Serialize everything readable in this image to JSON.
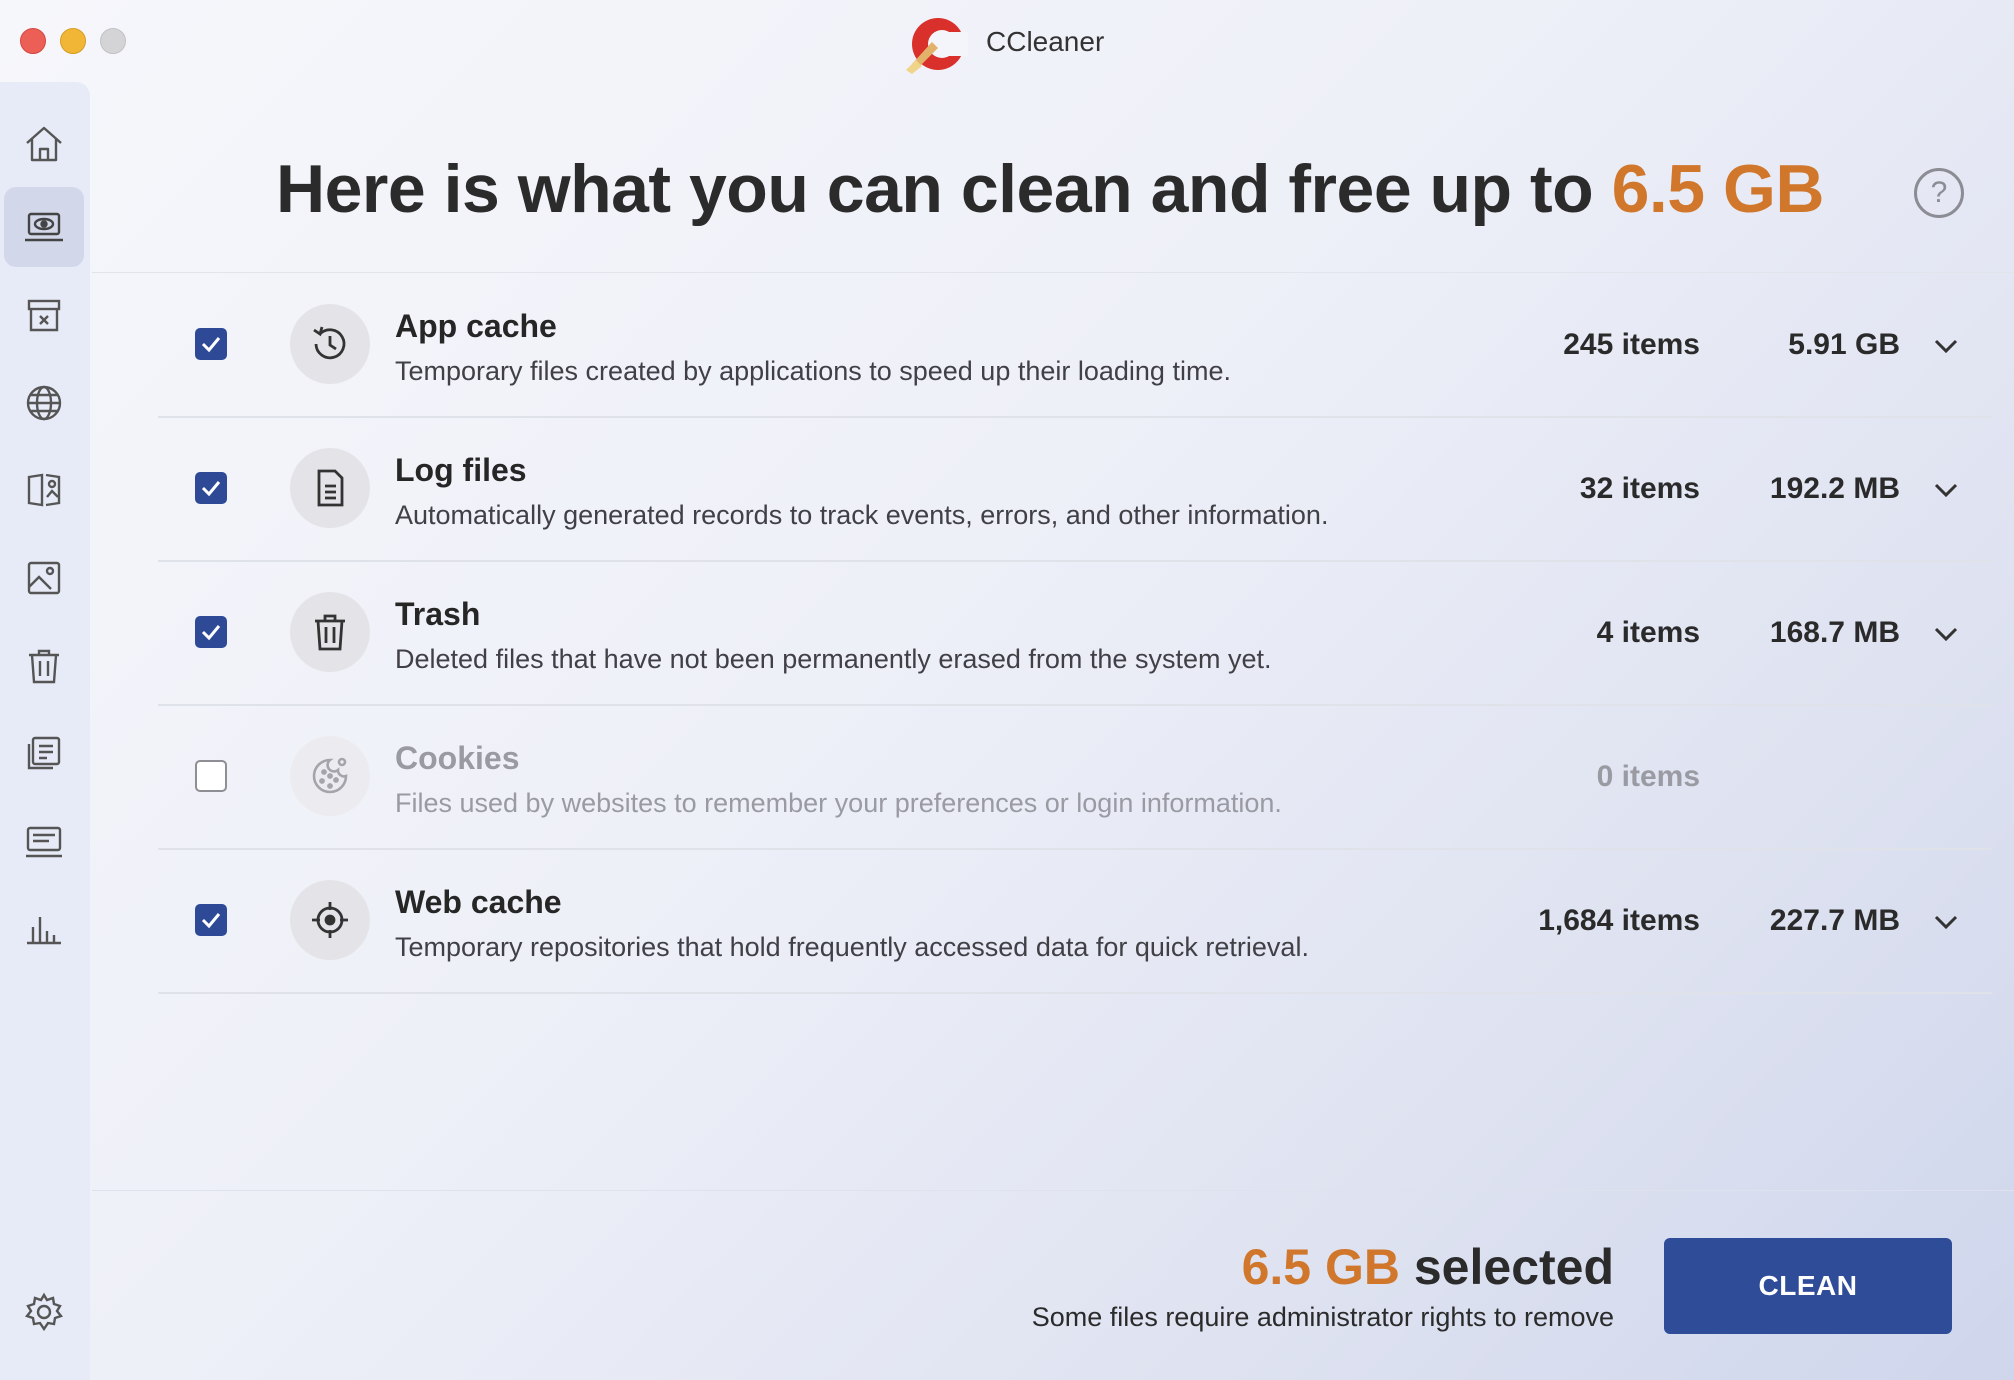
{
  "window": {
    "title": "CCleaner"
  },
  "sidebar": {
    "items": [
      {
        "icon": "home-icon",
        "active": false
      },
      {
        "icon": "laptop-eye-icon",
        "active": true
      },
      {
        "icon": "uninstall-box-icon",
        "active": false
      },
      {
        "icon": "globe-icon",
        "active": false
      },
      {
        "icon": "duplicate-files-icon",
        "active": false
      },
      {
        "icon": "photo-icon",
        "active": false
      },
      {
        "icon": "trash-icon",
        "active": false
      },
      {
        "icon": "startup-list-icon",
        "active": false
      },
      {
        "icon": "keyboard-icon",
        "active": false
      },
      {
        "icon": "bar-chart-icon",
        "active": false
      },
      {
        "icon": "gear-icon",
        "active": false
      }
    ]
  },
  "header": {
    "headline_prefix": "Here is what you can clean and free up to ",
    "headline_amount": "6.5 GB",
    "help_label": "?"
  },
  "rows": [
    {
      "title": "App cache",
      "description": "Temporary files created by applications to speed up their loading time.",
      "count": "245 items",
      "size": "5.91 GB",
      "checked": true,
      "icon": "history-clock-icon"
    },
    {
      "title": "Log files",
      "description": "Automatically generated records to track events, errors, and other information.",
      "count": "32 items",
      "size": "192.2 MB",
      "checked": true,
      "icon": "document-icon"
    },
    {
      "title": "Trash",
      "description": "Deleted files that have not been permanently erased from the system yet.",
      "count": "4 items",
      "size": "168.7 MB",
      "checked": true,
      "icon": "trash-icon"
    },
    {
      "title": "Cookies",
      "description": "Files used by websites to remember your preferences or login information.",
      "count": "0 items",
      "size": "",
      "checked": false,
      "icon": "cookie-icon"
    },
    {
      "title": "Web cache",
      "description": "Temporary repositories that hold frequently accessed data for quick retrieval.",
      "count": "1,684 items",
      "size": "227.7 MB",
      "checked": true,
      "icon": "crosshair-icon"
    }
  ],
  "footer": {
    "selected_amount": "6.5 GB",
    "selected_suffix": " selected",
    "admin_note": "Some files require administrator rights to remove",
    "clean_label": "CLEAN"
  },
  "colors": {
    "accent_orange": "#d0772c",
    "primary_blue": "#2f4c99"
  }
}
